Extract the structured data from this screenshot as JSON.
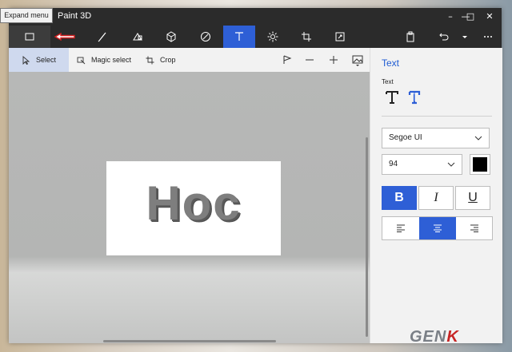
{
  "window": {
    "title": "Paint 3D",
    "controls": [
      "minimize",
      "maximize",
      "close"
    ]
  },
  "tooltip": {
    "text": "Expand menu"
  },
  "toolbar": {
    "tools": [
      {
        "name": "brushes",
        "icon": "brush-icon"
      },
      {
        "name": "2d-shapes",
        "icon": "shapes-icon"
      },
      {
        "name": "3d-shapes",
        "icon": "cube-icon"
      },
      {
        "name": "stickers",
        "icon": "sticker-icon"
      },
      {
        "name": "text",
        "icon": "text-icon",
        "active": true
      },
      {
        "name": "effects",
        "icon": "sun-icon"
      },
      {
        "name": "canvas",
        "icon": "crop-grid-icon"
      },
      {
        "name": "remix",
        "icon": "remix-icon"
      }
    ],
    "right": [
      "paste-icon",
      "undo-icon",
      "chevron-down-icon",
      "more-icon"
    ],
    "accent": "#2e5fd6"
  },
  "subbar": {
    "select_label": "Select",
    "magic_select_label": "Magic select",
    "crop_label": "Crop"
  },
  "canvas": {
    "text": "Hoc"
  },
  "panel": {
    "title": "Text",
    "section_label": "Text",
    "font_family": "Segoe UI",
    "font_size": "94",
    "text_color": "#000000",
    "bold_label": "B",
    "italic_label": "I",
    "underline_label": "U",
    "alignment_selected": "center"
  },
  "watermark": {
    "text1": "GEN",
    "text2": "K"
  }
}
